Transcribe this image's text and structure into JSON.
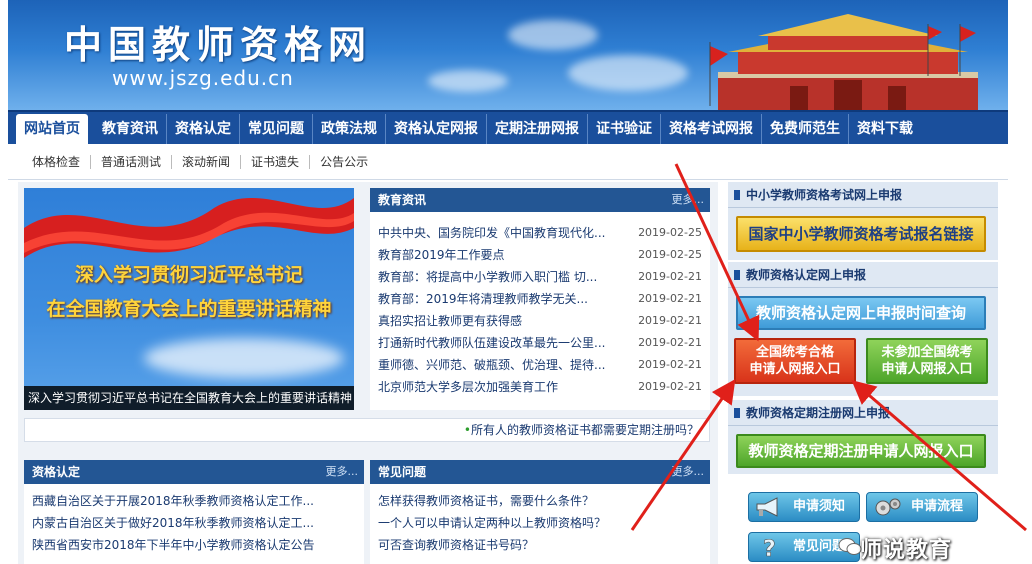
{
  "header": {
    "title": "中国教师资格网",
    "url": "www.jszg.edu.cn"
  },
  "nav": {
    "items": [
      "网站首页",
      "教育资讯",
      "资格认定",
      "常见问题",
      "政策法规",
      "资格认定网报",
      "定期注册网报",
      "证书验证",
      "资格考试网报",
      "免费师范生",
      "资料下载"
    ]
  },
  "subnav": {
    "items": [
      "体格检查",
      "普通话测试",
      "滚动新闻",
      "证书遗失",
      "公告公示"
    ]
  },
  "banner": {
    "line1": "深入学习贯彻习近平总书记",
    "line2": "在全国教育大会上的重要讲话精神",
    "caption": "深入学习贯彻习近平总书记在全国教育大会上的重要讲话精神"
  },
  "news": {
    "title": "教育资讯",
    "more": "更多...",
    "items": [
      {
        "title": "中共中央、国务院印发《中国教育现代化...",
        "date": "2019-02-25"
      },
      {
        "title": "教育部2019年工作要点",
        "date": "2019-02-25"
      },
      {
        "title": "教育部：将提高中小学教师入职门槛 切...",
        "date": "2019-02-21"
      },
      {
        "title": "教育部：2019年将清理教师教学无关...",
        "date": "2019-02-21"
      },
      {
        "title": "真招实招让教师更有获得感",
        "date": "2019-02-21"
      },
      {
        "title": "打通新时代教师队伍建设改革最先一公里...",
        "date": "2019-02-21"
      },
      {
        "title": "重师德、兴师范、破瓶颈、优治理、提待...",
        "date": "2019-02-21"
      },
      {
        "title": "北京师范大学多层次加强美育工作",
        "date": "2019-02-21"
      }
    ]
  },
  "notice": "所有人的教师资格证书都需要定期注册吗？",
  "qualification": {
    "title": "资格认定",
    "more": "更多...",
    "items": [
      "西藏自治区关于开展2018年秋季教师资格认定工作...",
      "内蒙古自治区关于做好2018年秋季教师资格认定工...",
      "陕西省西安市2018年下半年中小学教师资格认定公告"
    ]
  },
  "faq": {
    "title": "常见问题",
    "more": "更多...",
    "items": [
      "怎样获得教师资格证书，需要什么条件？",
      "一个人可以申请认定两种以上教师资格吗？",
      "可否查询教师资格证书号码？"
    ]
  },
  "right": {
    "exam_head": "中小学教师资格考试网上申报",
    "exam_btn": "国家中小学教师资格考试报名链接",
    "cert_head": "教师资格认定网上申报",
    "cert_time_btn": "教师资格认定网上申报时间查询",
    "red_btn_1": "全国统考合格",
    "red_btn_2": "申请人网报入口",
    "green_btn_1": "未参加全国统考",
    "green_btn_2": "申请人网报入口",
    "reg_head": "教师资格定期注册网上申报",
    "reg_btn": "教师资格定期注册申请人网报入口",
    "icon_btns": [
      "申请须知",
      "申请流程",
      "常见问题"
    ]
  },
  "watermark": "师说教育"
}
